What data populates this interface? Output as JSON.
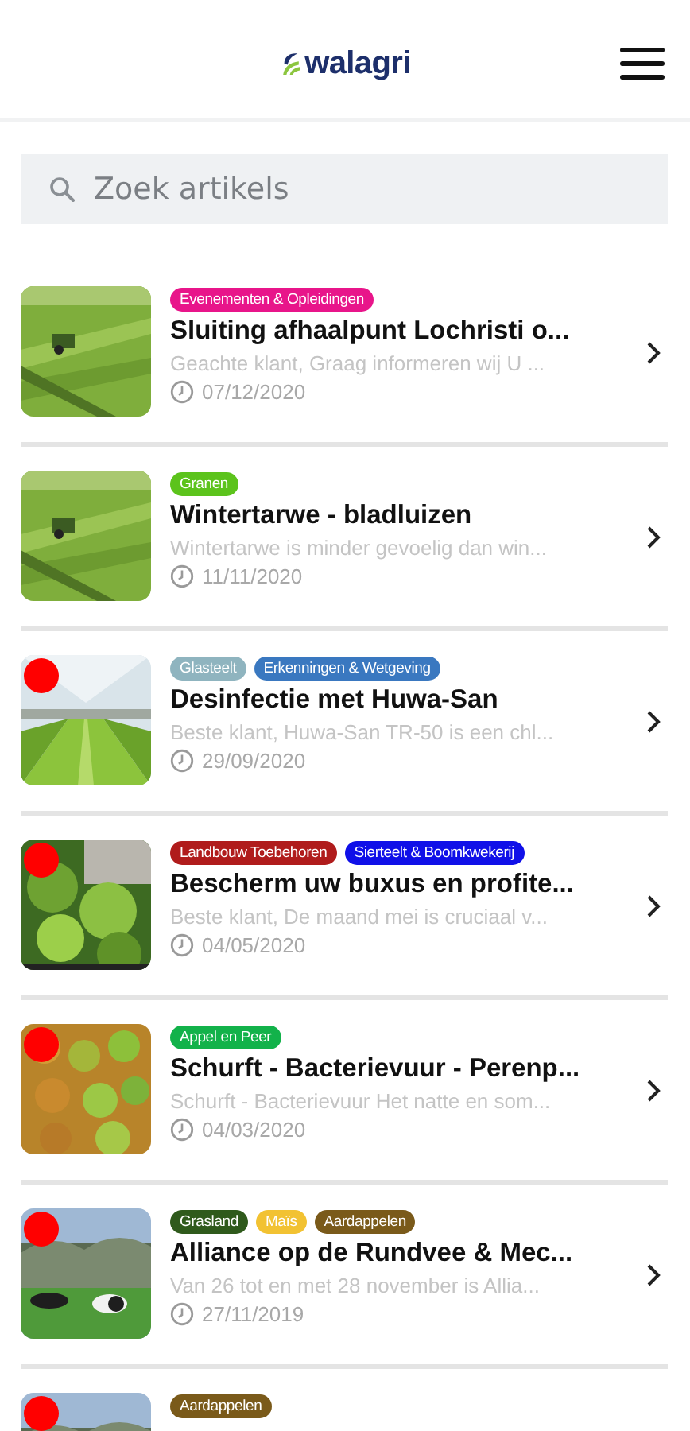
{
  "header": {
    "logo": "walagri"
  },
  "search": {
    "placeholder": "Zoek artikels"
  },
  "articles": [
    {
      "tags": [
        {
          "label": "Evenementen & Opleidingen",
          "color": "#e8158a"
        }
      ],
      "title": "Sluiting afhaalpunt Lochristi o...",
      "excerpt": "Geachte klant, Graag informeren wij U ...",
      "date": "07/12/2020",
      "unread": false
    },
    {
      "tags": [
        {
          "label": "Granen",
          "color": "#5cc31c"
        }
      ],
      "title": "Wintertarwe - bladluizen",
      "excerpt": "Wintertarwe is minder gevoelig dan win...",
      "date": "11/11/2020",
      "unread": false
    },
    {
      "tags": [
        {
          "label": "Glasteelt",
          "color": "#8fb4bf"
        },
        {
          "label": "Erkenningen & Wetgeving",
          "color": "#3a78c0"
        }
      ],
      "title": "Desinfectie met Huwa-San",
      "excerpt": "Beste klant, Huwa-San TR-50 is een chl...",
      "date": "29/09/2020",
      "unread": true
    },
    {
      "tags": [
        {
          "label": "Landbouw Toebehoren",
          "color": "#b01c1c"
        },
        {
          "label": "Sierteelt & Boomkwekerij",
          "color": "#1010e8"
        }
      ],
      "title": "Bescherm uw buxus en profite...",
      "excerpt": "Beste klant, De maand mei is cruciaal v...",
      "date": "04/05/2020",
      "unread": true
    },
    {
      "tags": [
        {
          "label": "Appel en Peer",
          "color": "#12b24a"
        }
      ],
      "title": "Schurft - Bacterievuur - Perenp...",
      "excerpt": "Schurft - Bacterievuur Het natte en som...",
      "date": "04/03/2020",
      "unread": true
    },
    {
      "tags": [
        {
          "label": "Grasland",
          "color": "#2f5a1c"
        },
        {
          "label": "Maïs",
          "color": "#f2c232"
        },
        {
          "label": "Aardappelen",
          "color": "#7a5a1a"
        }
      ],
      "title": "Alliance op de Rundvee & Mec...",
      "excerpt": "Van 26 tot en met 28 november is Allia...",
      "date": "27/11/2019",
      "unread": true
    },
    {
      "tags": [
        {
          "label": "Aardappelen",
          "color": "#7a5a1a"
        }
      ],
      "unread": true
    }
  ]
}
